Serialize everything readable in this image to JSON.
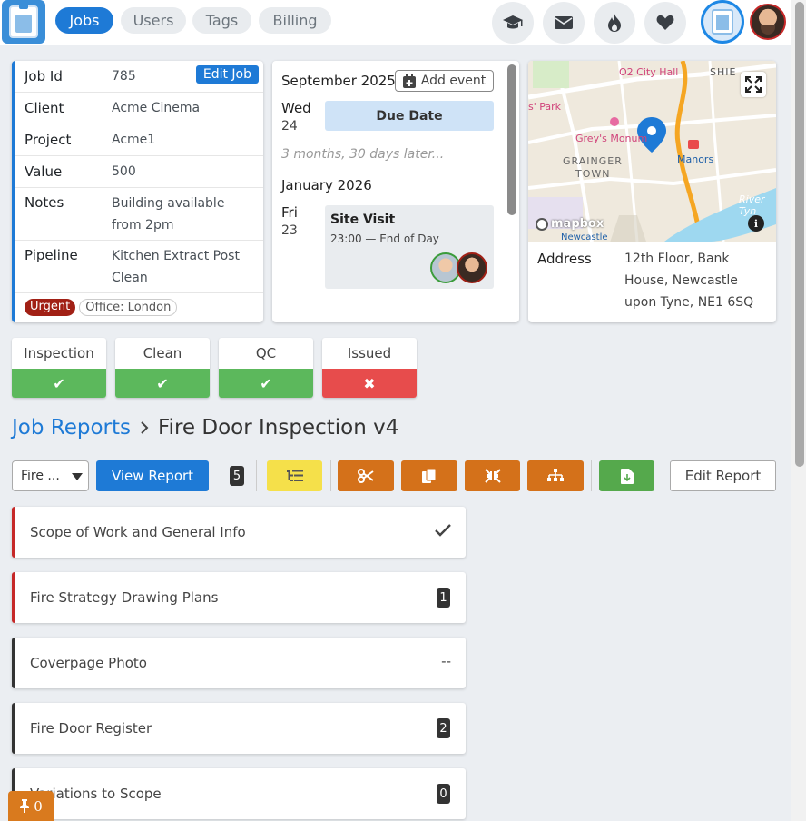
{
  "nav": {
    "tabs": [
      {
        "label": "Jobs",
        "active": true
      },
      {
        "label": "Users",
        "active": false
      },
      {
        "label": "Tags",
        "active": false
      },
      {
        "label": "Billing",
        "active": false
      }
    ],
    "icons": [
      "graduation-cap-icon",
      "envelope-icon",
      "fire-icon",
      "heart-icon"
    ]
  },
  "job": {
    "edit_label": "Edit Job",
    "rows": [
      {
        "key": "Job Id",
        "value": "785"
      },
      {
        "key": "Client",
        "value": "Acme Cinema"
      },
      {
        "key": "Project",
        "value": "Acme1"
      },
      {
        "key": "Value",
        "value": "500"
      },
      {
        "key": "Notes",
        "value": "Building available from 2pm"
      },
      {
        "key": "Pipeline",
        "value": "Kitchen Extract Post Clean"
      }
    ],
    "badges": {
      "urgent": "Urgent",
      "office": "Office: London"
    }
  },
  "calendar": {
    "month1": "September 2025",
    "add_event": "Add event",
    "day1_name": "Wed",
    "day1_num": "24",
    "due_label": "Due Date",
    "gap_text": "3 months, 30 days later...",
    "month2": "January 2026",
    "day2_name": "Fri",
    "day2_num": "23",
    "visit_title": "Site Visit",
    "visit_time": "23:00 — End of Day"
  },
  "map": {
    "labels": {
      "city_hall": "O2 City Hall",
      "shield": "SHIE",
      "park": "s' Park",
      "monument": "Grey's Monum",
      "grainger1": "GRAINGER",
      "grainger2": "TOWN",
      "manors": "Manors",
      "river": "River Tyn",
      "newcastle": "Newcastle",
      "brand": "mapbox"
    },
    "address_label": "Address",
    "address_value": "12th Floor, Bank House, Newcastle upon Tyne, NE1 6SQ"
  },
  "stages": [
    {
      "label": "Inspection",
      "status": "done"
    },
    {
      "label": "Clean",
      "status": "done"
    },
    {
      "label": "QC",
      "status": "done"
    },
    {
      "label": "Issued",
      "status": "failed"
    }
  ],
  "breadcrumb": {
    "parent": "Job Reports",
    "current": "Fire Door Inspection v4"
  },
  "toolbar": {
    "select_value": "Fire ...",
    "view_report": "View Report",
    "count": "5",
    "edit_report": "Edit Report"
  },
  "sections": [
    {
      "title": "Scope of Work and General Info",
      "right": "✓",
      "type": "check"
    },
    {
      "title": "Fire Strategy Drawing Plans",
      "right": "1",
      "type": "count"
    },
    {
      "title": "Coverpage Photo",
      "right": "--",
      "type": "text"
    },
    {
      "title": "Fire Door Register",
      "right": "2",
      "type": "count"
    },
    {
      "title": "Variations to Scope",
      "right": "0",
      "type": "count"
    }
  ],
  "pin": {
    "count": "0"
  },
  "colors": {
    "primary": "#1e7ad6",
    "success": "#5cb85c",
    "danger": "#e74c4c",
    "warning": "#f5e04a",
    "orange": "#d4711a",
    "green_btn": "#55a94c",
    "urgent": "#a12015"
  }
}
